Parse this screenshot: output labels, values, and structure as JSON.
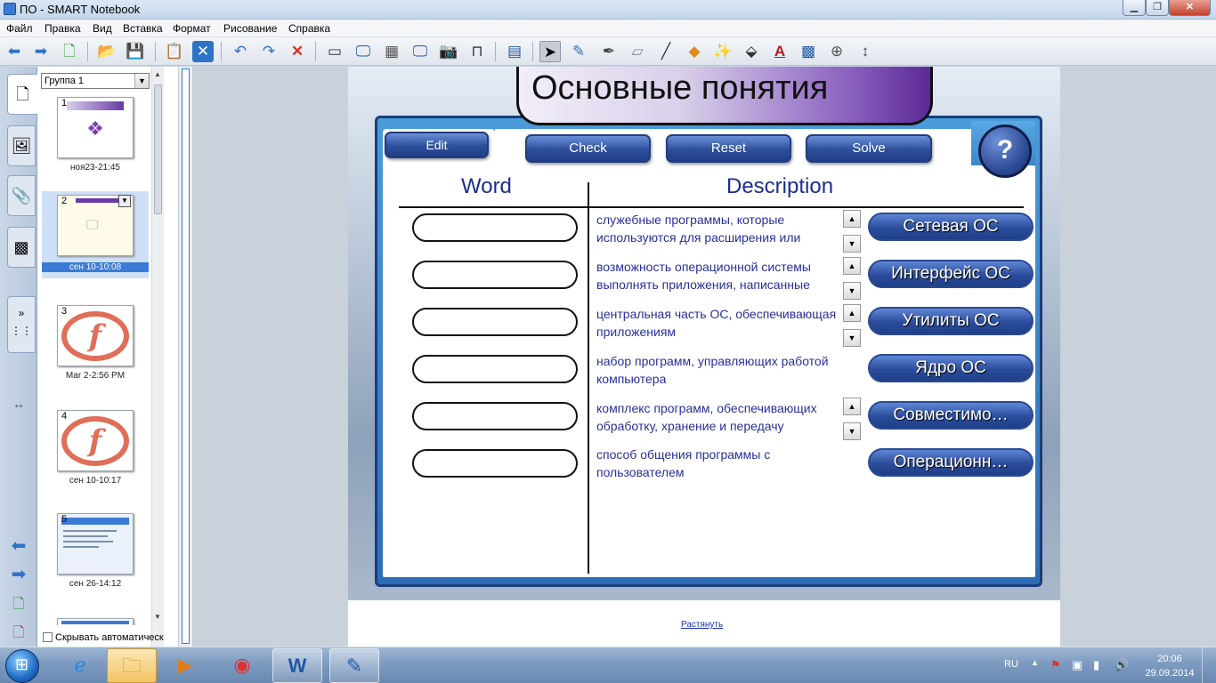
{
  "window": {
    "title": "ПО - SMART Notebook"
  },
  "menu": [
    "Файл",
    "Правка",
    "Вид",
    "Вставка",
    "Формат",
    "Рисование",
    "Справка"
  ],
  "toolbar_icons": [
    "back-icon",
    "forward-icon",
    "add-page-icon",
    "open-icon",
    "save-icon",
    "paste-icon",
    "delete-page-icon",
    "undo-icon",
    "redo-icon",
    "delete-icon",
    "screen-shade-icon",
    "full-screen-icon",
    "transparent-bg-icon",
    "dual-page-icon",
    "capture-icon",
    "document-camera-icon",
    "table-icon",
    "select-icon",
    "pen-icon",
    "creative-pen-icon",
    "eraser-icon",
    "line-icon",
    "shape-icon",
    "magic-pen-icon",
    "fill-icon",
    "text-icon",
    "properties-icon",
    "measure-icon",
    "move-toolbar-icon"
  ],
  "sorter": {
    "group": "Группа 1",
    "pages": [
      {
        "num": "1",
        "caption": "ноя23-21:45"
      },
      {
        "num": "2",
        "caption": "сен 10-10:08"
      },
      {
        "num": "3",
        "caption": "Mar 2-2:56 PM"
      },
      {
        "num": "4",
        "caption": "сен 10-10:17"
      },
      {
        "num": "5",
        "caption": "сен 26-14:12"
      }
    ],
    "autohide": "Скрывать автоматическ"
  },
  "slide": {
    "title": "Основные понятия",
    "buttons": {
      "edit": "Edit",
      "check": "Check",
      "reset": "Reset",
      "solve": "Solve",
      "help": "?"
    },
    "col_word": "Word",
    "col_desc": "Description",
    "rows": [
      {
        "desc": "служебные программы, которые используются для расширения или",
        "answer": "Сетевая ОС",
        "spinner": true
      },
      {
        "desc": "возможность операционной системы выполнять приложения, написанные",
        "answer": "Интерфейс ОС",
        "spinner": true
      },
      {
        "desc": "центральная часть ОС, обеспечивающая приложениям",
        "answer": "Утилиты ОС",
        "spinner": true
      },
      {
        "desc": "набор программ, управляющих работой компьютера",
        "answer": "Ядро ОС",
        "spinner": false
      },
      {
        "desc": "комплекс программ, обеспечивающих обработку, хранение и передачу",
        "answer": "Совместимо…",
        "spinner": true
      },
      {
        "desc": "способ общения программы с пользователем",
        "answer": "Операционн…",
        "spinner": false
      }
    ],
    "stretch_link": "Растянуть"
  },
  "taskbar": {
    "apps": [
      "ie-icon",
      "explorer-icon",
      "media-player-icon",
      "chrome-icon",
      "word-icon",
      "smart-notebook-icon"
    ],
    "lang": "RU",
    "time": "20:06",
    "date": "29.09.2014"
  }
}
